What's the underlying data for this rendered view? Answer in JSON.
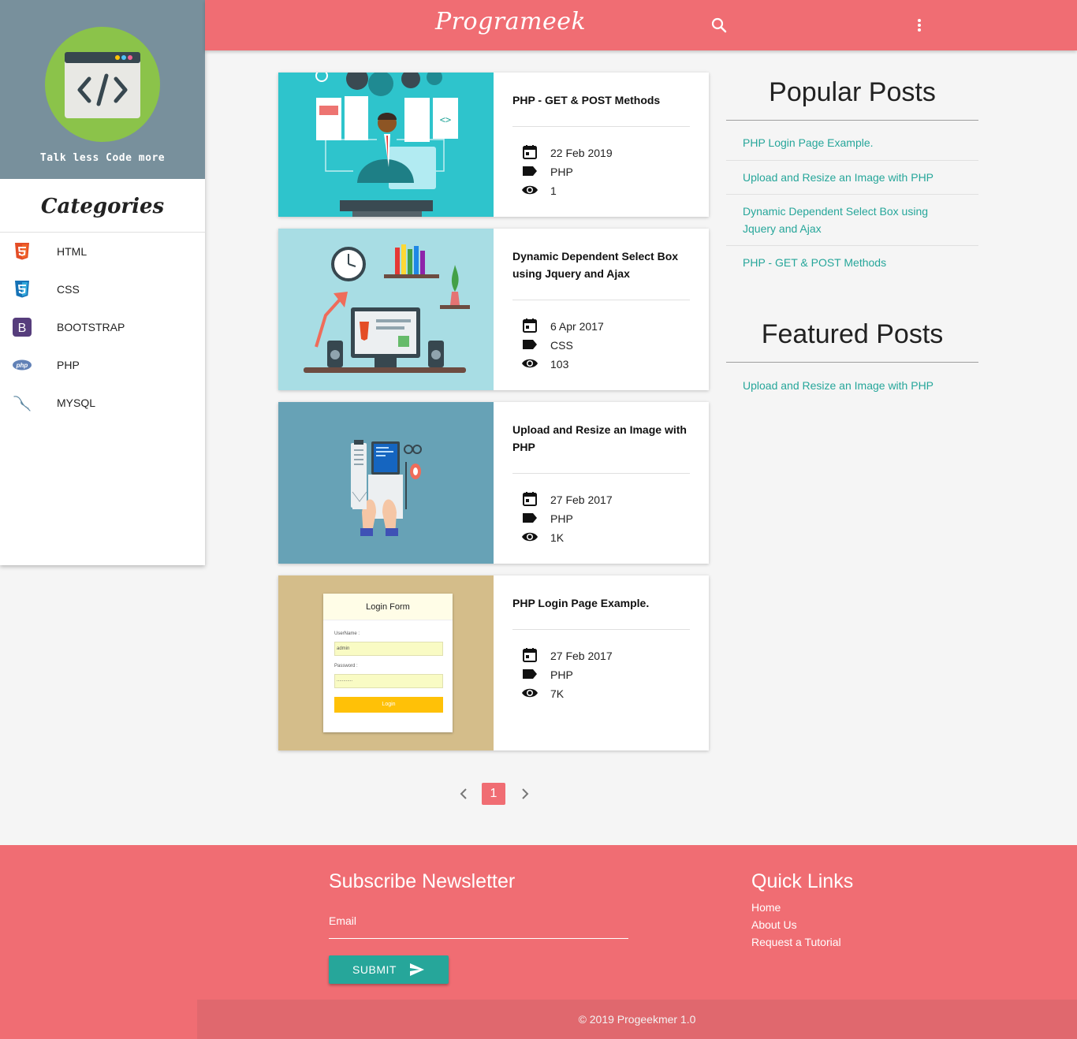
{
  "header": {
    "brand": "Programeek"
  },
  "sidebar": {
    "tagline": "Talk less Code more",
    "categories_title": "Categories",
    "categories": [
      {
        "label": "HTML",
        "icon": "html5-icon"
      },
      {
        "label": "CSS",
        "icon": "css3-icon"
      },
      {
        "label": "BOOTSTRAP",
        "icon": "bootstrap-icon"
      },
      {
        "label": "PHP",
        "icon": "php-icon"
      },
      {
        "label": "MYSQL",
        "icon": "mysql-icon"
      }
    ]
  },
  "posts": [
    {
      "title": "PHP - GET & POST Methods",
      "date": "22 Feb 2019",
      "category": "PHP",
      "views": "1"
    },
    {
      "title": "Dynamic Dependent Select Box using Jquery and Ajax",
      "date": "6 Apr 2017",
      "category": "CSS",
      "views": "103"
    },
    {
      "title": "Upload and Resize an Image with PHP",
      "date": "27 Feb 2017",
      "category": "PHP",
      "views": "1K"
    },
    {
      "title": "PHP Login Page Example.",
      "date": "27 Feb 2017",
      "category": "PHP",
      "views": "7K",
      "image_text": {
        "form_title": "Login Form",
        "username_label": "UserName :",
        "username_value": "admin",
        "password_label": "Password :",
        "password_value": "............",
        "button": "Login"
      }
    }
  ],
  "popular": {
    "title": "Popular Posts",
    "links": [
      "PHP Login Page Example.",
      "Upload and Resize an Image with PHP",
      "Dynamic Dependent Select Box using Jquery and Ajax",
      "PHP - GET & POST Methods"
    ]
  },
  "featured": {
    "title": "Featured Posts",
    "links": [
      "Upload and Resize an Image with PHP"
    ]
  },
  "pagination": {
    "current": "1"
  },
  "footer": {
    "newsletter_title": "Subscribe Newsletter",
    "email_label": "Email",
    "submit_label": "SUBMIT",
    "quick_links_title": "Quick Links",
    "quick_links": [
      "Home",
      "About Us",
      "Request a Tutorial"
    ],
    "copyright": "© 2019 Progeekmer 1.0"
  },
  "colors": {
    "primary": "#f06d73",
    "accent": "#26a69a",
    "sidebar_head": "#78909c",
    "logo": "#8bc34a"
  }
}
